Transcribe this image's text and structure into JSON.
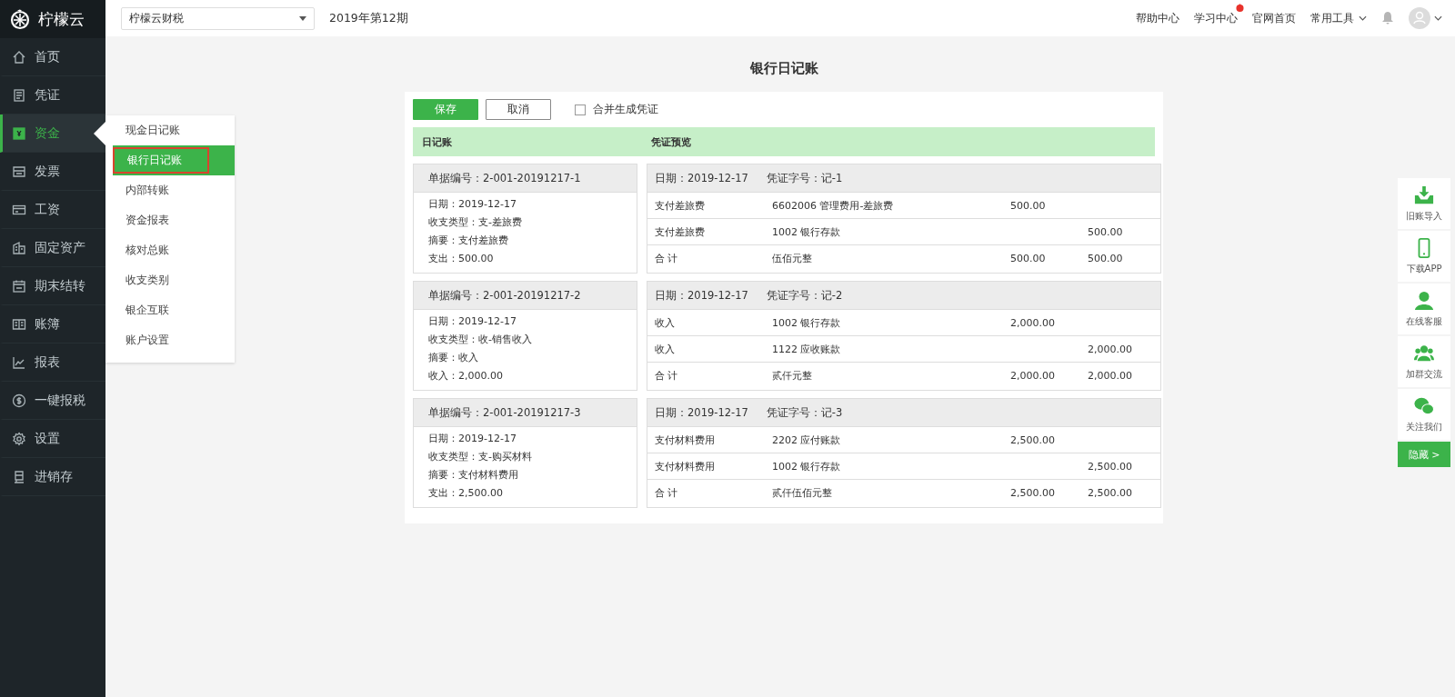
{
  "logo": {
    "text": "柠檬云"
  },
  "nav": [
    {
      "label": "首页",
      "selected": false
    },
    {
      "label": "凭证",
      "selected": false
    },
    {
      "label": "资金",
      "selected": true
    },
    {
      "label": "发票",
      "selected": false
    },
    {
      "label": "工资",
      "selected": false
    },
    {
      "label": "固定资产",
      "selected": false
    },
    {
      "label": "期末结转",
      "selected": false
    },
    {
      "label": "账簿",
      "selected": false
    },
    {
      "label": "报表",
      "selected": false
    },
    {
      "label": "一键报税",
      "selected": false
    },
    {
      "label": "设置",
      "selected": false
    },
    {
      "label": "进销存",
      "selected": false
    }
  ],
  "submenu": [
    {
      "label": "现金日记账",
      "selected": false
    },
    {
      "label": "银行日记账",
      "selected": true
    },
    {
      "label": "内部转账",
      "selected": false
    },
    {
      "label": "资金报表",
      "selected": false
    },
    {
      "label": "核对总账",
      "selected": false
    },
    {
      "label": "收支类别",
      "selected": false
    },
    {
      "label": "银企互联",
      "selected": false
    },
    {
      "label": "账户设置",
      "selected": false
    }
  ],
  "topbar": {
    "company": "柠檬云财税",
    "period": "2019年第12期",
    "links": [
      "帮助中心",
      "学习中心",
      "官网首页"
    ],
    "tools": "常用工具"
  },
  "page_title": "银行日记账",
  "toolbar": {
    "save": "保存",
    "cancel": "取消",
    "merge": {
      "label": "合并生成凭证",
      "checked": false
    }
  },
  "section_header": {
    "left": "日记账",
    "right": "凭证预览"
  },
  "entries": [
    {
      "journal": {
        "number": "单据编号：2-001-20191217-1",
        "lines": [
          "日期：2019-12-17",
          "收支类型：支-差旅费",
          "摘要：支付差旅费",
          "支出：500.00"
        ]
      },
      "voucher": {
        "date": "日期：2019-12-17",
        "voucher_no": "凭证字号：记-1",
        "rows": [
          {
            "summary": "支付差旅费",
            "account": "6602006 管理费用-差旅费",
            "debit": "500.00"
          },
          {
            "summary": "支付差旅费",
            "account": "1002 银行存款",
            "credit": "500.00"
          },
          {
            "summary": "合 计",
            "account": "伍佰元整",
            "debit": "500.00",
            "credit": "500.00"
          }
        ]
      }
    },
    {
      "journal": {
        "number": "单据编号：2-001-20191217-2",
        "lines": [
          "日期：2019-12-17",
          "收支类型：收-销售收入",
          "摘要：收入",
          "收入：2,000.00"
        ]
      },
      "voucher": {
        "date": "日期：2019-12-17",
        "voucher_no": "凭证字号：记-2",
        "rows": [
          {
            "summary": "收入",
            "account": "1002 银行存款",
            "debit": "2,000.00"
          },
          {
            "summary": "收入",
            "account": "1122 应收账款",
            "credit": "2,000.00"
          },
          {
            "summary": "合 计",
            "account": "贰仟元整",
            "debit": "2,000.00",
            "credit": "2,000.00"
          }
        ]
      }
    },
    {
      "journal": {
        "number": "单据编号：2-001-20191217-3",
        "lines": [
          "日期：2019-12-17",
          "收支类型：支-购买材料",
          "摘要：支付材料费用",
          "支出：2,500.00"
        ]
      },
      "voucher": {
        "date": "日期：2019-12-17",
        "voucher_no": "凭证字号：记-3",
        "rows": [
          {
            "summary": "支付材料费用",
            "account": "2202 应付账款",
            "debit": "2,500.00"
          },
          {
            "summary": "支付材料费用",
            "account": "1002 银行存款",
            "credit": "2,500.00"
          },
          {
            "summary": "合 计",
            "account": "贰仟伍佰元整",
            "debit": "2,500.00",
            "credit": "2,500.00"
          }
        ]
      }
    }
  ],
  "float_panel": {
    "items": [
      "旧账导入",
      "下载APP",
      "在线客服",
      "加群交流",
      "关注我们"
    ],
    "hide": "隐藏 >"
  }
}
